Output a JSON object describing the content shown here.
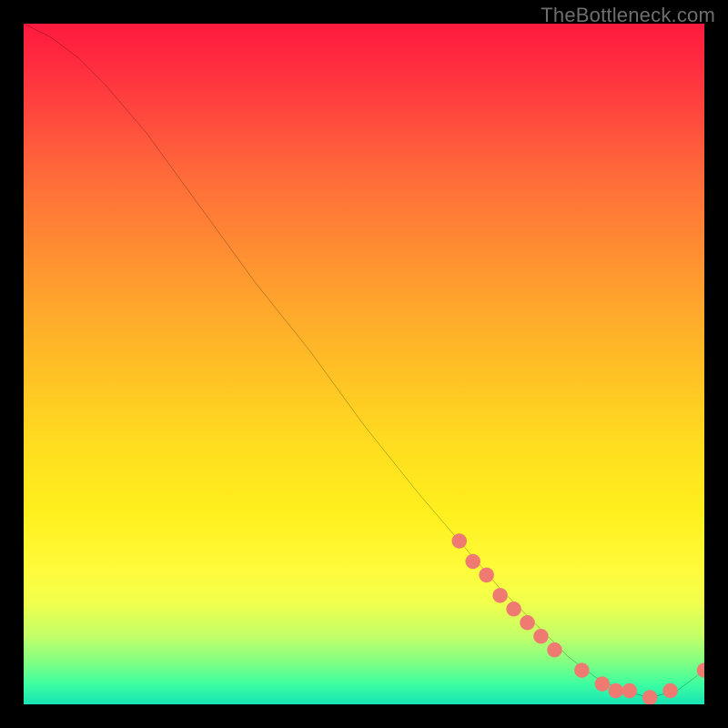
{
  "watermark": "TheBottleneck.com",
  "chart_data": {
    "type": "line",
    "title": "",
    "xlabel": "",
    "ylabel": "",
    "xlim": [
      0,
      100
    ],
    "ylim": [
      0,
      100
    ],
    "series": [
      {
        "name": "curve",
        "x": [
          0,
          4,
          8,
          12,
          18,
          26,
          34,
          42,
          50,
          58,
          64,
          70,
          75,
          80,
          84,
          88,
          92,
          96,
          100
        ],
        "y": [
          100,
          98,
          95,
          91,
          84,
          73,
          62,
          52,
          41,
          31,
          24,
          17,
          12,
          7,
          4,
          2,
          1,
          2,
          5
        ]
      }
    ],
    "markers": [
      {
        "x": 64,
        "y": 24
      },
      {
        "x": 66,
        "y": 21
      },
      {
        "x": 68,
        "y": 19
      },
      {
        "x": 70,
        "y": 16
      },
      {
        "x": 72,
        "y": 14
      },
      {
        "x": 74,
        "y": 12
      },
      {
        "x": 76,
        "y": 10
      },
      {
        "x": 78,
        "y": 8
      },
      {
        "x": 82,
        "y": 5
      },
      {
        "x": 85,
        "y": 3
      },
      {
        "x": 87,
        "y": 2
      },
      {
        "x": 89,
        "y": 2
      },
      {
        "x": 92,
        "y": 1
      },
      {
        "x": 95,
        "y": 2
      },
      {
        "x": 100,
        "y": 5
      }
    ],
    "marker_color": "#ef7a72",
    "line_color": "#000000",
    "gradient_stops": [
      {
        "pct": 0,
        "color": "#ff1a3e"
      },
      {
        "pct": 42,
        "color": "#ffa82c"
      },
      {
        "pct": 72,
        "color": "#fff01e"
      },
      {
        "pct": 94,
        "color": "#7dff84"
      },
      {
        "pct": 100,
        "color": "#17e3b4"
      }
    ]
  }
}
